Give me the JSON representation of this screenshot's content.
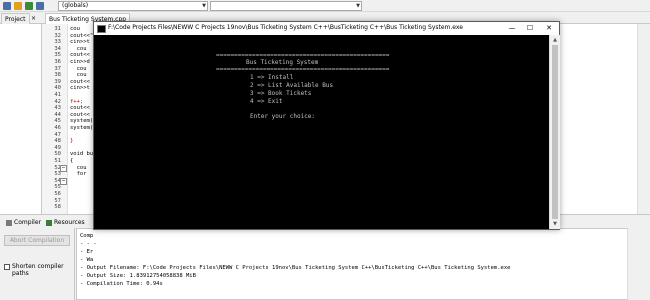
{
  "toolbar": {
    "scope_combo": "(globals)",
    "symbol_combo": ""
  },
  "tabs": {
    "project_tab": "Project",
    "editor_tab": "Bus Ticketing System.cpp"
  },
  "editor": {
    "line_numbers": [
      "31",
      "32",
      "33",
      "34",
      "35",
      "36",
      "37",
      "38",
      "39",
      "40",
      "41",
      "42",
      "43",
      "44",
      "45",
      "46",
      "47",
      "48",
      "49",
      "50",
      "51",
      "52",
      "53",
      "54",
      "55",
      "56",
      "57",
      "58"
    ],
    "visible_code": [
      "cou",
      "cout<<\"",
      "cin>>t",
      "  cou",
      "cout<<",
      "cin>>d",
      "  cou",
      "  cou",
      "cout<<",
      "cin>>t",
      "",
      "f++;",
      "cout<<",
      "cout<<",
      "system(",
      "system(",
      "",
      "}",
      "",
      "void bu",
      "{",
      "  cou",
      "  for",
      "",
      "",
      "",
      "",
      ""
    ]
  },
  "console": {
    "title": "F:\\Code Projects Files\\NEWW C Projects 19nov\\Bus Ticketing System C++\\BusTicketing C++\\Bus Ticketing System.exe",
    "minimize_icon": "minimize-icon",
    "maximize_icon": "maximize-icon",
    "close_icon": "close-icon",
    "separator": "================================================",
    "heading": "Bus Ticketing System",
    "menu": [
      "1 => Install",
      "2 => List Available Bus",
      "3 => Book Tickets",
      "4 => Exit"
    ],
    "prompt": "Enter your choice:"
  },
  "bottom": {
    "compiler_tab": "Compiler",
    "resources_tab": "Resources",
    "abort_button": "Abort Compilation",
    "shorten_label": "Shorten compiler paths",
    "log_lines": [
      "Comp",
      "- - -",
      "- Er",
      "- Wa",
      "- Output Filename: F:\\Code Projects Files\\NEWW C Projects 19nov\\Bus Ticketing System C++\\BusTicketing C++\\Bus Ticketing System.exe",
      "- Output Size: 1.83912754058838 MiB",
      "- Compilation Time: 0.94s"
    ]
  }
}
